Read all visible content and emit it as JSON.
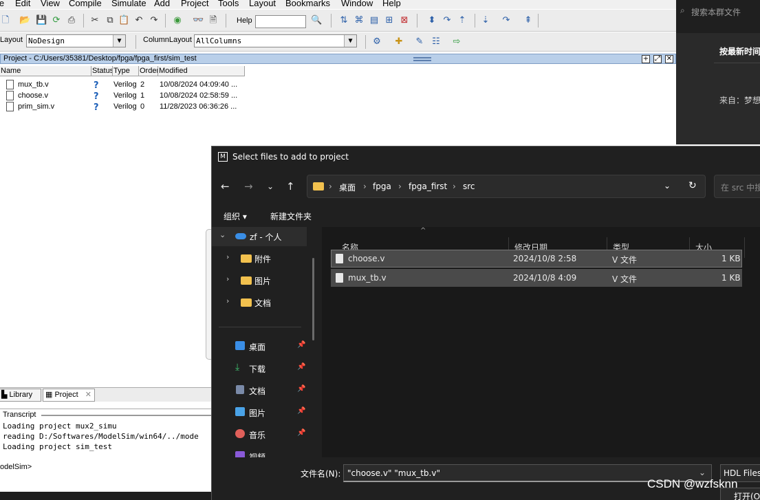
{
  "modelsim": {
    "menu": [
      "le",
      "Edit",
      "View",
      "Compile",
      "Simulate",
      "Add",
      "Project",
      "Tools",
      "Layout",
      "Bookmarks",
      "Window",
      "Help"
    ],
    "toolbar": {
      "help_label": "Help",
      "layout_label": "Layout",
      "layout_value": "NoDesign",
      "column_layout_label": "ColumnLayout",
      "column_layout_value": "AllColumns"
    },
    "project_title": "Project - C:/Users/35381/Desktop/fpga/fpga_first/sim_test",
    "columns": [
      "Name",
      "Status",
      "Type",
      "Order",
      "Modified"
    ],
    "files": [
      {
        "name": "mux_tb.v",
        "status": "?",
        "type": "Verilog",
        "order": "2",
        "modified": "10/08/2024 04:09:40 ..."
      },
      {
        "name": "choose.v",
        "status": "?",
        "type": "Verilog",
        "order": "1",
        "modified": "10/08/2024 02:58:59 ..."
      },
      {
        "name": "prim_sim.v",
        "status": "?",
        "type": "Verilog",
        "order": "0",
        "modified": "11/28/2023 06:36:26 ..."
      }
    ],
    "tabs": [
      "Library",
      "Project"
    ],
    "transcript_title": "Transcript",
    "transcript_lines": [
      "Loading project mux2_simu",
      "reading D:/Softwares/ModelSim/win64/../mode",
      "Loading project sim_test"
    ],
    "prompt": "odelSim>"
  },
  "csdn": {
    "search_placeholder": "搜索本群文件",
    "sort_label": "按最新时间",
    "from_label": "来自：梦想"
  },
  "dialog": {
    "logo": "M",
    "title": "Select files to add to project",
    "breadcrumb": [
      "桌面",
      "fpga",
      "fpga_first",
      "src"
    ],
    "search_placeholder": "在 src 中搜",
    "organize_label": "组织 ▾",
    "new_folder_label": "新建文件夹",
    "nav_root": "zf - 个人",
    "nav_folders": [
      "附件",
      "图片",
      "文档"
    ],
    "quick_access": [
      "桌面",
      "下载",
      "文档",
      "图片",
      "音乐",
      "视频"
    ],
    "list_headers": [
      "名称",
      "修改日期",
      "类型",
      "大小"
    ],
    "list_rows": [
      {
        "name": "choose.v",
        "date": "2024/10/8 2:58",
        "type": "V 文件",
        "size": "1 KB"
      },
      {
        "name": "mux_tb.v",
        "date": "2024/10/8 4:09",
        "type": "V 文件",
        "size": "1 KB"
      }
    ],
    "filename_label": "文件名(N):",
    "filename_value": "\"choose.v\" \"mux_tb.v\"",
    "filetype_value": "HDL Files",
    "open_label": "打开(O"
  },
  "watermark": "CSDN @wzfsknn",
  "colors": {
    "project_title_bg": "#b9cfe9",
    "dialog_bg": "#202020",
    "folder_yellow": "#f2c14e",
    "onedrive_blue": "#3a8ee6"
  }
}
